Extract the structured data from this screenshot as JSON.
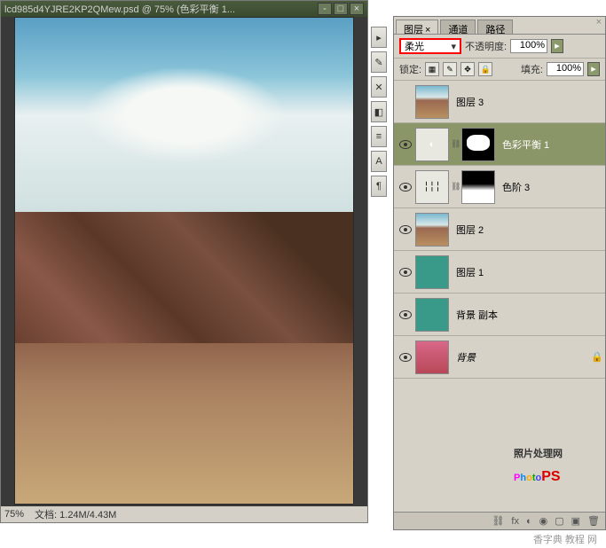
{
  "doc": {
    "title": "lcd985d4YJRE2KP2QMew.psd @ 75% (色彩平衡 1...",
    "zoom": "75%",
    "fileinfo": "文档: 1.24M/4.43M"
  },
  "panel": {
    "tabs": {
      "layers": "图层",
      "channels": "通道",
      "paths": "路径"
    },
    "blend_mode": "柔光",
    "opacity_label": "不透明度:",
    "opacity_value": "100%",
    "lock_label": "锁定:",
    "fill_label": "填充:",
    "fill_value": "100%"
  },
  "layers": [
    {
      "name": "图层 3",
      "visible": false,
      "selected": false,
      "type": "image"
    },
    {
      "name": "色彩平衡 1",
      "visible": true,
      "selected": true,
      "type": "adjustment"
    },
    {
      "name": "色阶 3",
      "visible": true,
      "selected": false,
      "type": "adjustment"
    },
    {
      "name": "图层 2",
      "visible": true,
      "selected": false,
      "type": "image"
    },
    {
      "name": "图层 1",
      "visible": true,
      "selected": false,
      "type": "solid"
    },
    {
      "name": "背景 副本",
      "visible": true,
      "selected": false,
      "type": "solid"
    },
    {
      "name": "背景",
      "visible": true,
      "selected": false,
      "type": "bg",
      "locked": true
    }
  ],
  "watermark": {
    "text": "照片处理网",
    "logo": "PhotoPS"
  },
  "bottom_wm": "香字典 教程 网"
}
